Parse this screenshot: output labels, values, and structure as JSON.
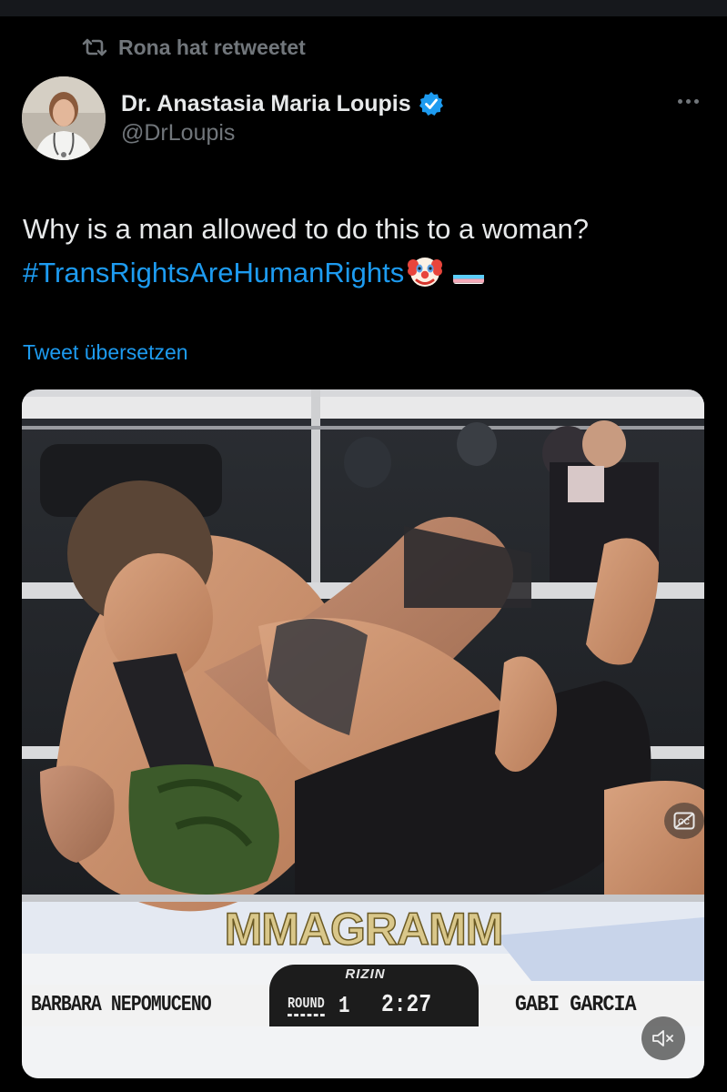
{
  "retweet": {
    "label": "Rona hat retweetet",
    "icon": "retweet-icon"
  },
  "author": {
    "display_name": "Dr. Anastasia Maria Loupis",
    "handle": "@DrLoupis",
    "verified": true,
    "verified_color": "#1d9bf0"
  },
  "tweet": {
    "text": "Why is a man allowed to do this to a woman?",
    "hashtag": "#TransRightsAreHumanRights",
    "emojis": [
      "clown-face-emoji",
      "transgender-flag-emoji"
    ],
    "translate_label": "Tweet übersetzen"
  },
  "video": {
    "watermark": "MMAGRAMM",
    "broadcaster_logo": "RIZIN",
    "scoreboard": {
      "fighter_left": "BARBARA NEPOMUCENO",
      "fighter_right": "GABI GARCIA",
      "round_label": "ROUND",
      "round_number": "1",
      "time": "2:27",
      "logo": "RIZIN"
    },
    "controls": [
      "captions-icon",
      "mute-icon"
    ]
  },
  "colors": {
    "background": "#000000",
    "text": "#e7e9ea",
    "secondary_text": "#71767b",
    "link": "#1d9bf0"
  }
}
